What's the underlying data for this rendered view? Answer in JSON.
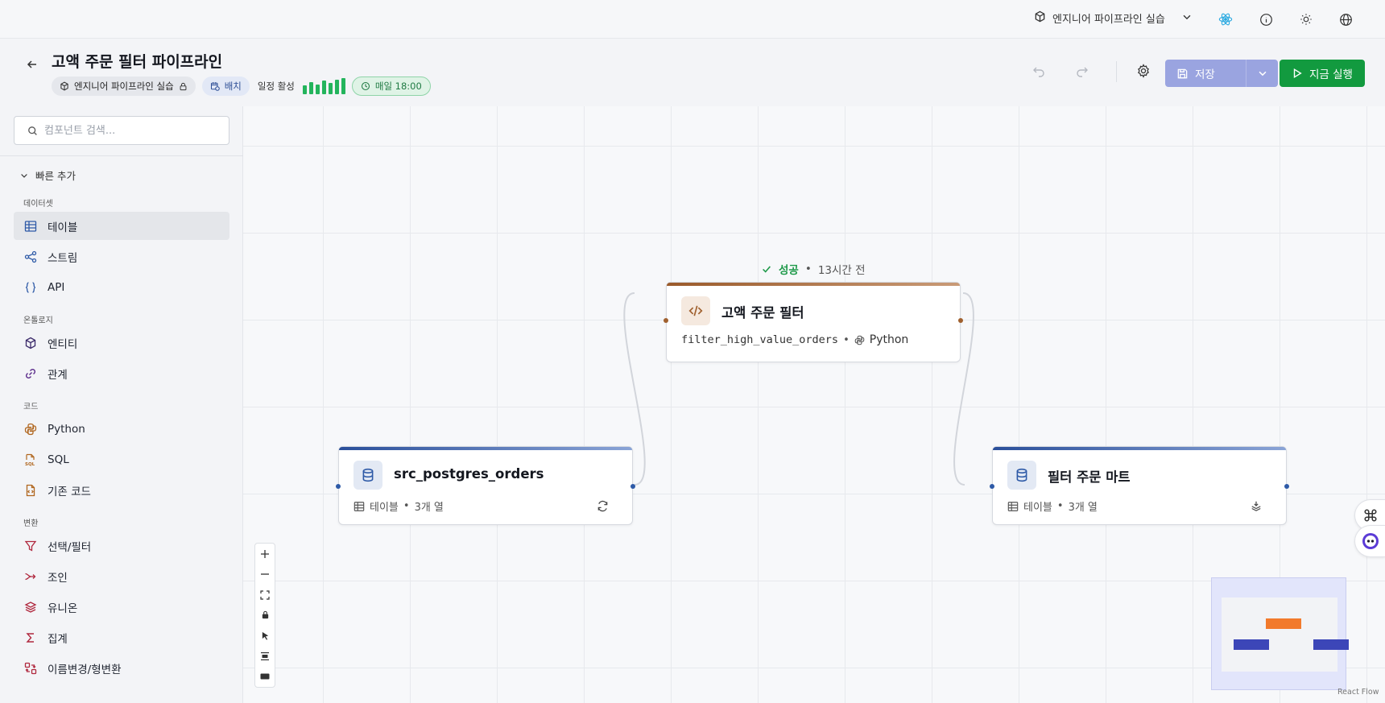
{
  "topbar": {
    "project_name": "엔지니어 파이프라인 실습",
    "icons": [
      "cube-icon",
      "chevron-down-icon",
      "react-atom-icon",
      "info-icon",
      "sun-icon",
      "globe-icon"
    ]
  },
  "header": {
    "title": "고액 주문 필터 파이프라인",
    "project_chip": "엔지니어 파이프라인 실습",
    "batch_chip": "배치",
    "schedule_label": "일정 활성",
    "schedule_bars": [
      0.55,
      0.75,
      0.6,
      0.85,
      0.7,
      0.9,
      1.0
    ],
    "schedule_time": "매일 18:00",
    "save_label": "저장",
    "run_label": "지금 실행"
  },
  "sidebar": {
    "search_placeholder": "컴포넌트 검색...",
    "quick_add": "빠른 추가",
    "sections": {
      "dataset": "데이터셋",
      "ontology": "온톨로지",
      "code": "코드",
      "transform": "변환"
    },
    "items": {
      "table": "테이블",
      "stream": "스트림",
      "api": "API",
      "entity": "엔티티",
      "relation": "관계",
      "python": "Python",
      "sql": "SQL",
      "legacy_code": "기존 코드",
      "select_filter": "선택/필터",
      "join": "조인",
      "union": "유니온",
      "aggregate": "집계",
      "rename_cast": "이름변경/형변환"
    }
  },
  "canvas": {
    "status_ok": "성공",
    "status_ago": "13시간 전",
    "nodes": {
      "source": {
        "title": "src_postgres_orders",
        "type": "테이블",
        "columns": "3개 열"
      },
      "filter": {
        "title": "고액 주문 필터",
        "function": "filter_high_value_orders",
        "language": "Python"
      },
      "mart": {
        "title": "필터 주문 마트",
        "type": "테이블",
        "columns": "3개 열"
      }
    },
    "attribution": "React Flow"
  },
  "colors": {
    "accent_blue": "#2e5aa7",
    "accent_orange": "#a0602e",
    "run_green": "#129a3f",
    "save_purple": "#9aa4e0",
    "minimap_blue": "#3c46b8",
    "minimap_orange": "#f27a2c"
  }
}
